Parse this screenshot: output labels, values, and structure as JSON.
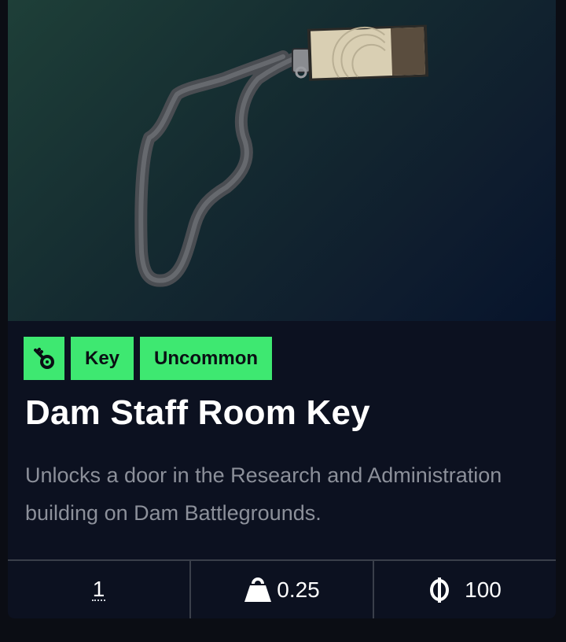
{
  "item": {
    "image_alt": "Lanyard with keycard",
    "tags": {
      "type_icon": "key-icon",
      "category": "Key",
      "rarity": "Uncommon"
    },
    "title": "Dam Staff Room Key",
    "description": "Unlocks a door in the Research and Administration building on Dam Battlegrounds.",
    "stats": {
      "quantity": "1",
      "weight_icon": "weight-icon",
      "weight": "0.25",
      "value_icon": "coin-icon",
      "value": "100"
    }
  },
  "colors": {
    "tag_background": "#3ee871",
    "card_background": "#0c1120"
  }
}
